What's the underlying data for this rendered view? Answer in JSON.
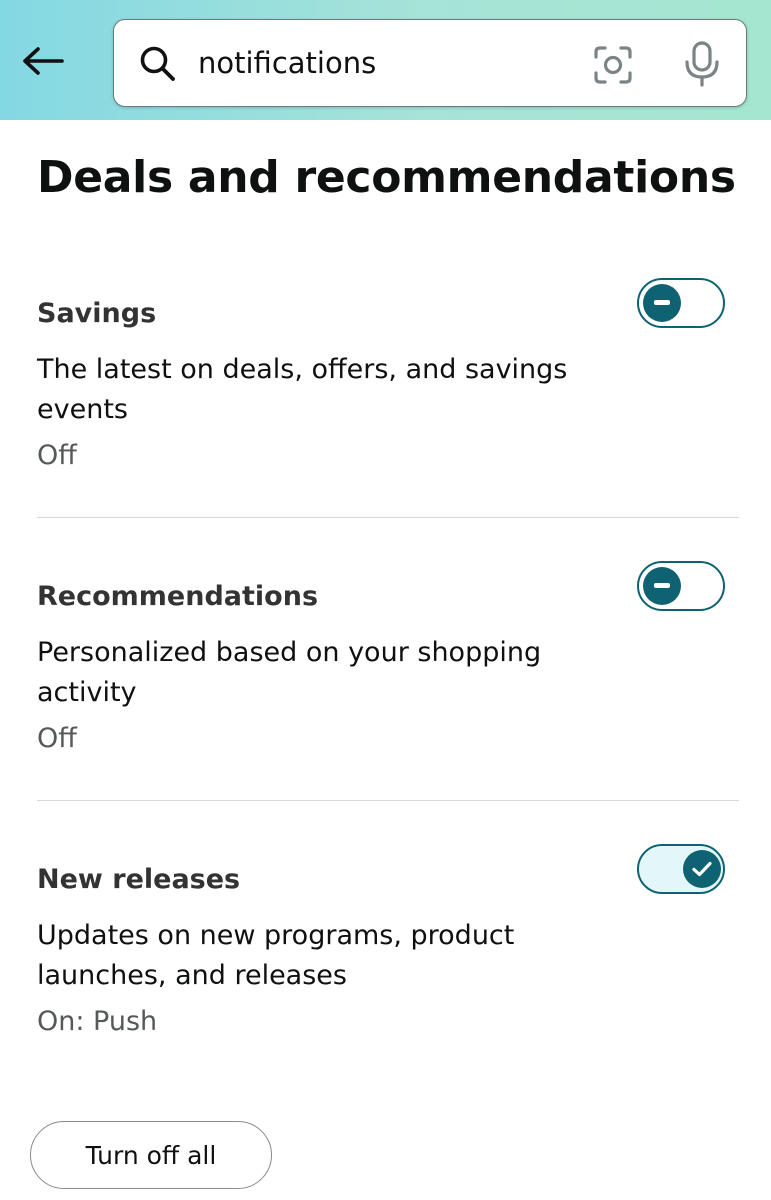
{
  "search": {
    "value": "notifications"
  },
  "page": {
    "title": "Deals and recommendations"
  },
  "settings": [
    {
      "title": "Savings",
      "description": "The latest on deals, offers, and savings events",
      "status": "Off",
      "enabled": false
    },
    {
      "title": "Recommendations",
      "description": "Personalized based on your shopping activity",
      "status": "Off",
      "enabled": false
    },
    {
      "title": "New releases",
      "description": "Updates on new programs, product launches, and releases",
      "status": "On: Push",
      "enabled": true
    }
  ],
  "actions": {
    "turn_off_all_label": "Turn off all"
  },
  "icons": {
    "back": "arrow-left-icon",
    "search": "search-icon",
    "camera": "camera-scan-icon",
    "mic": "microphone-icon",
    "toggle_off": "minus-icon",
    "toggle_on": "check-icon"
  },
  "colors": {
    "header_gradient_start": "#84d8e3",
    "header_gradient_end": "#a5e6d0",
    "toggle_accent": "#0e6272",
    "toggle_on_track": "#e3f7fa",
    "divider": "#d5d9d9",
    "secondary_text": "#565959"
  }
}
